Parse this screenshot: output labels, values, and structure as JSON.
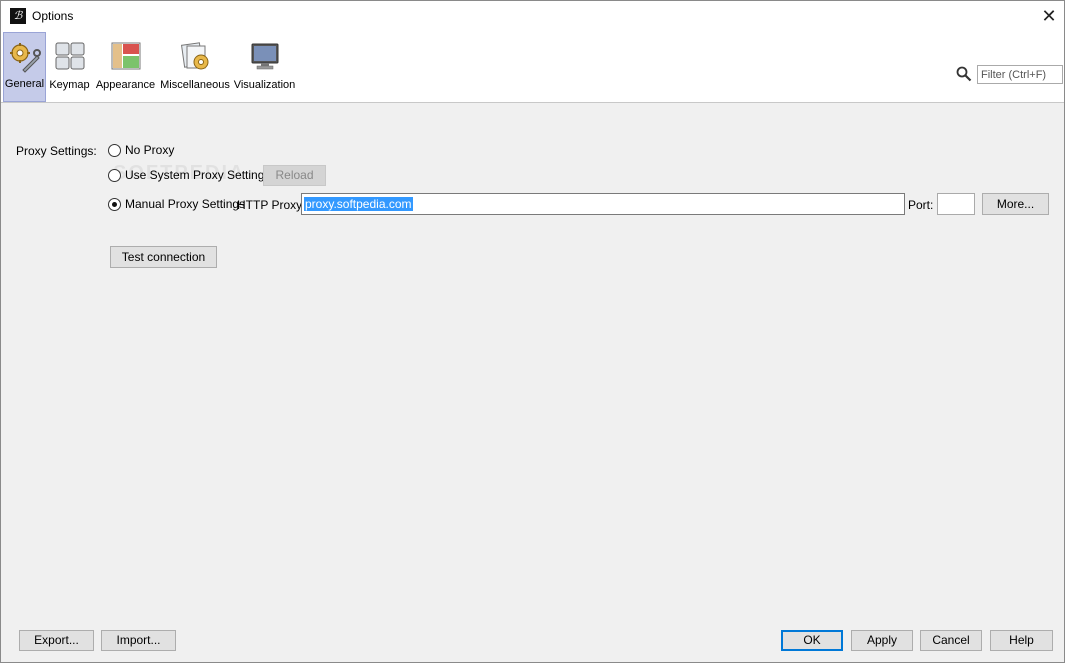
{
  "window": {
    "title": "Options",
    "app_icon_glyph": "ℬ"
  },
  "toolbar": {
    "categories": [
      {
        "label": "General",
        "icon": "gear-wrench-icon",
        "selected": true
      },
      {
        "label": "Keymap",
        "icon": "keyboard-icon",
        "selected": false
      },
      {
        "label": "Appearance",
        "icon": "layout-icon",
        "selected": false
      },
      {
        "label": "Miscellaneous",
        "icon": "misc-gear-icon",
        "selected": false
      },
      {
        "label": "Visualization",
        "icon": "monitor-icon",
        "selected": false
      }
    ],
    "filter_placeholder": "Filter (Ctrl+F)",
    "filter_value": ""
  },
  "proxy": {
    "label": "Proxy Settings:",
    "options": [
      {
        "label": "No Proxy",
        "checked": false
      },
      {
        "label": "Use System Proxy Settings",
        "checked": false
      },
      {
        "label": "Manual Proxy Settings",
        "checked": true
      }
    ],
    "reload_label": "Reload",
    "http_proxy_label": "HTTP Proxy:",
    "http_proxy_value": "proxy.softpedia.com",
    "port_label": "Port:",
    "port_value": "",
    "more_label": "More...",
    "test_connection_label": "Test connection"
  },
  "footer": {
    "export_label": "Export...",
    "import_label": "Import...",
    "ok_label": "OK",
    "apply_label": "Apply",
    "cancel_label": "Cancel",
    "help_label": "Help"
  },
  "colors": {
    "selected_tab": "#c5cbe9",
    "selection": "#3399ff",
    "accent": "#0078d7"
  }
}
